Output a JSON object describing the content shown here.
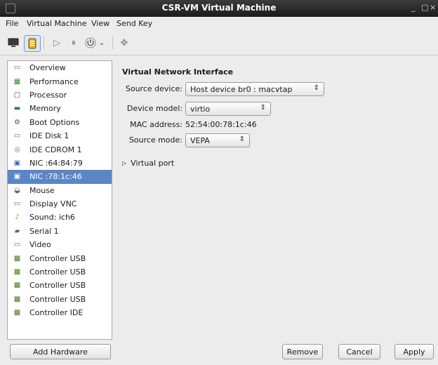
{
  "window": {
    "title": "CSR-VM Virtual Machine",
    "minimize": "_",
    "maximize": "□",
    "close": "×"
  },
  "menubar": {
    "file": "File",
    "virtual_machine": "Virtual Machine",
    "view": "View",
    "send_key": "Send Key"
  },
  "toolbar": {
    "icons": [
      "monitor-icon",
      "details-icon",
      "run-icon",
      "pause-icon",
      "power-icon",
      "dropdown-icon",
      "fullscreen-icon"
    ]
  },
  "sidebar": {
    "items": [
      {
        "label": "Overview",
        "icon": "overview-icon"
      },
      {
        "label": "Performance",
        "icon": "performance-icon"
      },
      {
        "label": "Processor",
        "icon": "processor-icon"
      },
      {
        "label": "Memory",
        "icon": "memory-icon"
      },
      {
        "label": "Boot Options",
        "icon": "boot-options-icon"
      },
      {
        "label": "IDE Disk 1",
        "icon": "disk-icon"
      },
      {
        "label": "IDE CDROM 1",
        "icon": "cdrom-icon"
      },
      {
        "label": "NIC :64:84:79",
        "icon": "nic-icon"
      },
      {
        "label": "NIC :78:1c:46",
        "icon": "nic-icon",
        "selected": true
      },
      {
        "label": "Mouse",
        "icon": "mouse-icon"
      },
      {
        "label": "Display VNC",
        "icon": "display-icon"
      },
      {
        "label": "Sound: ich6",
        "icon": "sound-icon"
      },
      {
        "label": "Serial 1",
        "icon": "serial-icon"
      },
      {
        "label": "Video",
        "icon": "video-icon"
      },
      {
        "label": "Controller USB",
        "icon": "controller-icon"
      },
      {
        "label": "Controller USB",
        "icon": "controller-icon"
      },
      {
        "label": "Controller USB",
        "icon": "controller-icon"
      },
      {
        "label": "Controller USB",
        "icon": "controller-icon"
      },
      {
        "label": "Controller IDE",
        "icon": "controller-icon"
      }
    ]
  },
  "details": {
    "heading": "Virtual Network Interface",
    "source_device_label": "Source device:",
    "source_device_value": "Host device br0 : macvtap",
    "device_model_label": "Device model:",
    "device_model_value": "virtio",
    "mac_label": "MAC address:",
    "mac_value": "52:54:00:78:1c:46",
    "source_mode_label": "Source mode:",
    "source_mode_value": "VEPA",
    "virtual_port_label": "Virtual port"
  },
  "buttons": {
    "add_hardware": "Add Hardware",
    "remove": "Remove",
    "cancel": "Cancel",
    "apply": "Apply"
  },
  "colors": {
    "selection": "#5b86c6",
    "titlebar": "#2a2a2a"
  }
}
